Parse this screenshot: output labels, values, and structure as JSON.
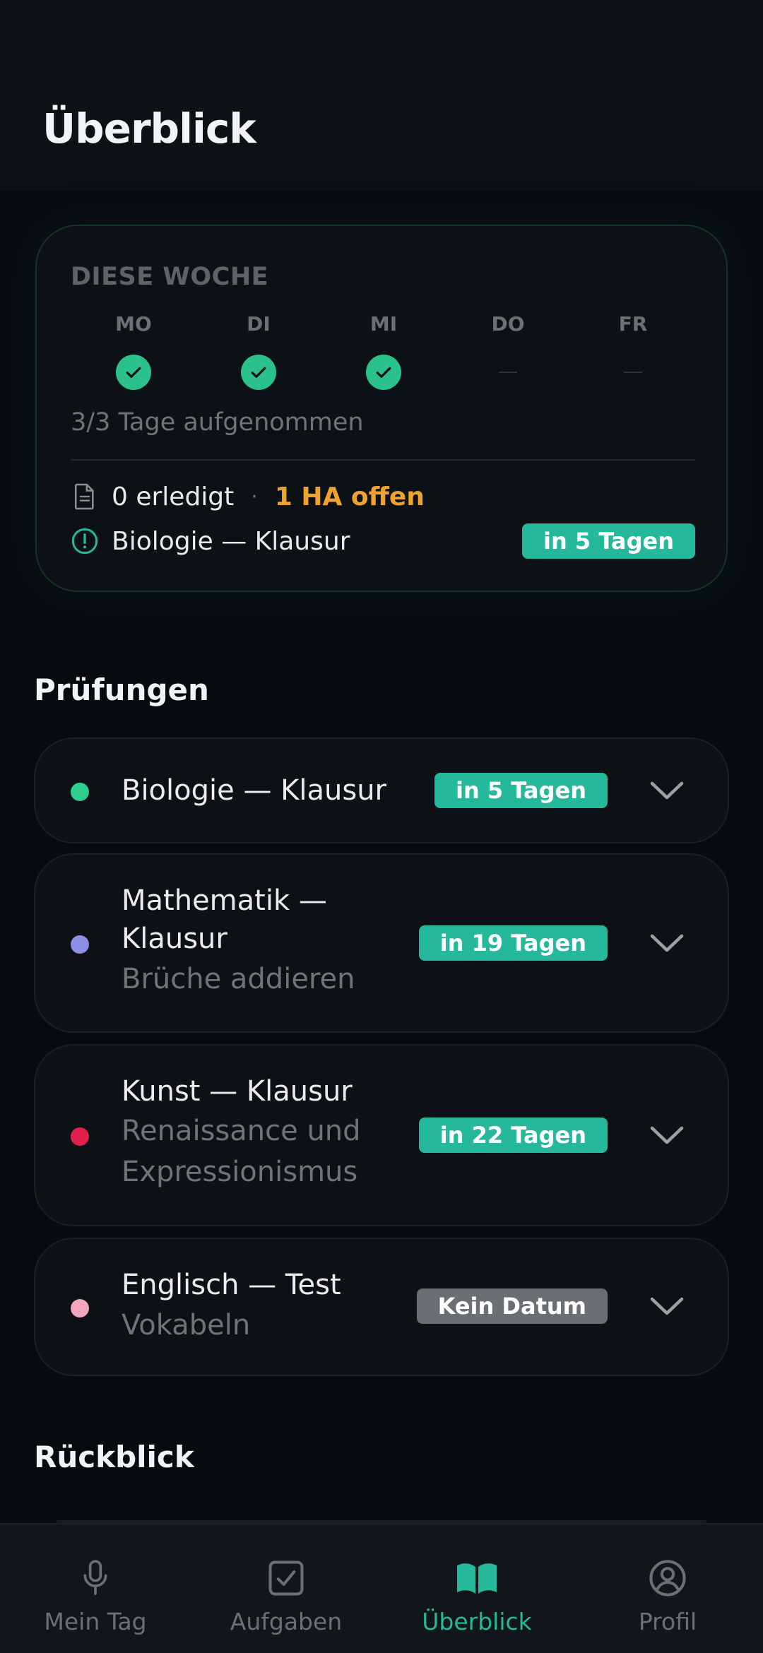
{
  "header": {
    "title": "Überblick"
  },
  "week": {
    "heading": "DIESE WOCHE",
    "days": [
      {
        "label": "MO",
        "recorded": true
      },
      {
        "label": "DI",
        "recorded": true
      },
      {
        "label": "MI",
        "recorded": true
      },
      {
        "label": "DO",
        "recorded": false,
        "placeholder": "—"
      },
      {
        "label": "FR",
        "recorded": false,
        "placeholder": "—"
      }
    ],
    "summary": "3/3 Tage aufgenommen",
    "done_text": "0 erledigt",
    "separator": "·",
    "open_text": "1 HA offen",
    "next_exam": "Biologie — Klausur",
    "next_exam_badge": "in 5 Tagen"
  },
  "exams": {
    "title": "Prüfungen",
    "items": [
      {
        "title": "Biologie — Klausur",
        "subtitle": "",
        "badge": "in 5 Tagen",
        "color": "#2fcf8f"
      },
      {
        "title": "Mathematik — Klausur",
        "subtitle": "Brüche addieren",
        "badge": "in 19 Tagen",
        "color": "#8b8fe8"
      },
      {
        "title": "Kunst — Klausur",
        "subtitle": "Renaissance und Expressionismus",
        "badge": "in 22 Tagen",
        "color": "#e0204a"
      },
      {
        "title": "Englisch — Test",
        "subtitle": "Vokabeln",
        "badge": "Kein Datum",
        "color": "#f2a5bd"
      }
    ]
  },
  "review": {
    "title": "Rückblick"
  },
  "nav": {
    "items": [
      {
        "label": "Mein Tag",
        "icon": "microphone-icon"
      },
      {
        "label": "Aufgaben",
        "icon": "checkbox-icon"
      },
      {
        "label": "Überblick",
        "icon": "book-icon",
        "active": true
      },
      {
        "label": "Profil",
        "icon": "profile-icon"
      }
    ]
  },
  "colors": {
    "accent": "#26b89a",
    "warning": "#f0a22e",
    "check": "#2bc18d"
  }
}
